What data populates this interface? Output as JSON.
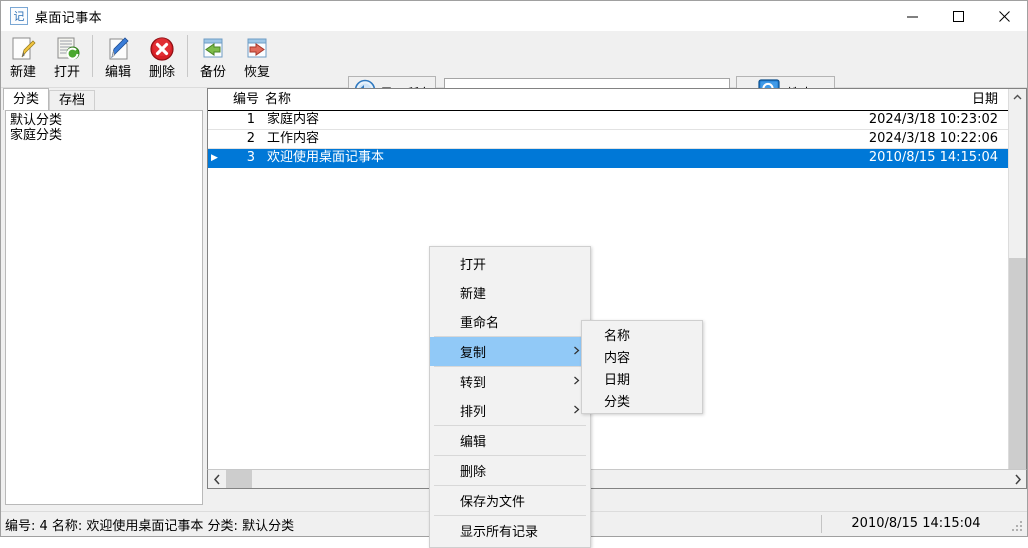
{
  "window": {
    "title": "桌面记事本",
    "app_icon": "记",
    "controls": {
      "minimize": "minimize-icon",
      "maximize": "maximize-icon",
      "close": "close-icon"
    }
  },
  "toolbar": {
    "buttons": [
      {
        "label": "新建",
        "icon": "new-note-icon"
      },
      {
        "label": "打开",
        "icon": "open-document-icon"
      },
      {
        "label": "编辑",
        "icon": "edit-pencil-icon"
      },
      {
        "label": "删除",
        "icon": "delete-cross-icon"
      },
      {
        "label": "备份",
        "icon": "backup-left-arrow-icon"
      },
      {
        "label": "恢复",
        "icon": "restore-right-arrow-icon"
      }
    ],
    "show_all": {
      "label": "显示所有",
      "icon": "back-circle-icon"
    },
    "search": {
      "label": "搜索",
      "icon": "search-magnifier-icon"
    },
    "search_input": {
      "value": "",
      "placeholder": ""
    }
  },
  "sidebar": {
    "tabs": [
      {
        "label": "分类",
        "active": true
      },
      {
        "label": "存档",
        "active": false
      }
    ],
    "categories": [
      {
        "label": "默认分类"
      },
      {
        "label": "家庭分类"
      }
    ]
  },
  "list": {
    "columns": [
      {
        "key": "marker",
        "label": ""
      },
      {
        "key": "id",
        "label": "编号"
      },
      {
        "key": "name",
        "label": "名称"
      },
      {
        "key": "date",
        "label": "日期"
      }
    ],
    "rows": [
      {
        "marker": "",
        "id": "1",
        "name": "家庭内容",
        "date": "2024/3/18 10:23:02",
        "selected": false
      },
      {
        "marker": "",
        "id": "2",
        "name": "工作内容",
        "date": "2024/3/18 10:22:06",
        "selected": false
      },
      {
        "marker": "▶",
        "id": "3",
        "name": "欢迎使用桌面记事本",
        "date": "2010/8/15 14:15:04",
        "selected": true
      }
    ],
    "scrollbar": {
      "up_arrow": "chevron-up-icon",
      "down_arrow": "chevron-down-icon",
      "left_arrow": "chevron-left-icon",
      "right_arrow": "chevron-right-icon"
    }
  },
  "context_menu": {
    "items": [
      {
        "label": "打开",
        "submenu": false,
        "highlight": false,
        "separator_after": false
      },
      {
        "label": "新建",
        "submenu": false,
        "highlight": false,
        "separator_after": false
      },
      {
        "label": "重命名",
        "submenu": false,
        "highlight": false,
        "separator_after": true
      },
      {
        "label": "复制",
        "submenu": true,
        "highlight": true,
        "separator_after": true
      },
      {
        "label": "转到",
        "submenu": true,
        "highlight": false,
        "separator_after": false
      },
      {
        "label": "排列",
        "submenu": true,
        "highlight": false,
        "separator_after": true
      },
      {
        "label": "编辑",
        "submenu": false,
        "highlight": false,
        "separator_after": true
      },
      {
        "label": "删除",
        "submenu": false,
        "highlight": false,
        "separator_after": true
      },
      {
        "label": "保存为文件",
        "submenu": false,
        "highlight": false,
        "separator_after": true
      },
      {
        "label": "显示所有记录",
        "submenu": false,
        "highlight": false,
        "separator_after": false
      }
    ],
    "submenu_arrow": "chevron-right-icon",
    "submenu": {
      "items": [
        {
          "label": "名称"
        },
        {
          "label": "内容"
        },
        {
          "label": "日期"
        },
        {
          "label": "分类"
        }
      ]
    }
  },
  "statusbar": {
    "info": "编号: 4  名称: 欢迎使用桌面记事本  分类: 默认分类",
    "date": "2010/8/15 14:15:04"
  },
  "colors": {
    "selection": "#0078d7",
    "menu_highlight": "#91c9f7",
    "window_bg": "#f0f0f0",
    "accent_blue": "#2b6fb5"
  }
}
